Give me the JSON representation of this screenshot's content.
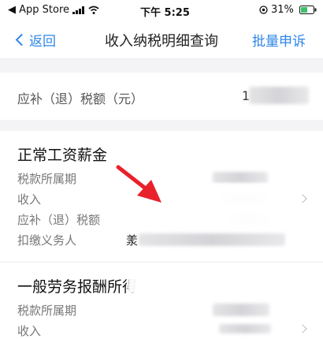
{
  "status_bar": {
    "carrier": "◀ App Store",
    "time": "下午 5:25",
    "battery": "31%"
  },
  "nav": {
    "back_label": "返回",
    "title": "收入纳税明细查询",
    "action_label": "批量申诉"
  },
  "summary": {
    "label": "应补（退）税额（元）",
    "value_prefix": "1"
  },
  "records": [
    {
      "title": "正常工资薪金",
      "fields": [
        "税款所属期",
        "收入",
        "应补（退）税额",
        "扣缴义务人"
      ],
      "withholder_prefix": "羕"
    },
    {
      "title": "一般劳务报酬所得",
      "fields": [
        "税款所属期",
        "收入"
      ]
    }
  ],
  "colors": {
    "accent": "#2f86e8",
    "annotation_arrow": "#e8212b"
  }
}
